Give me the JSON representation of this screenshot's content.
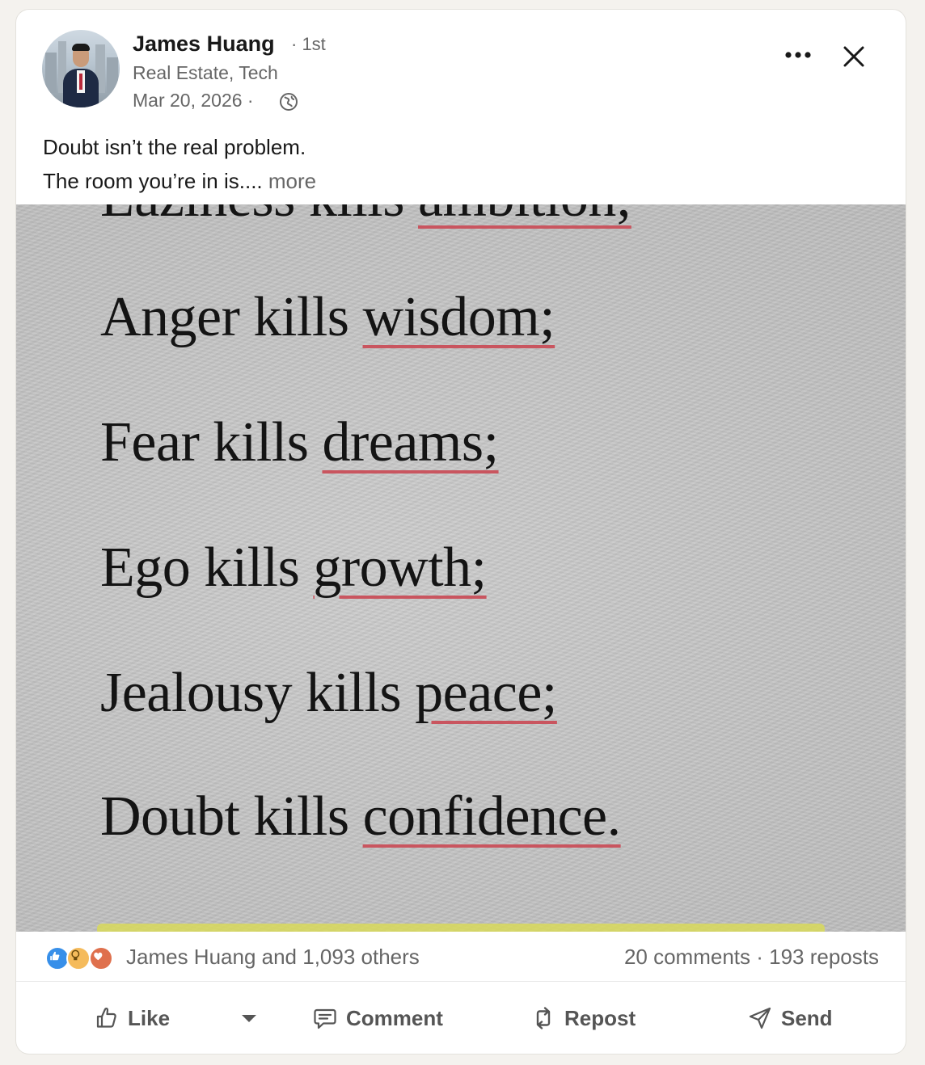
{
  "author": {
    "name": "James Huang",
    "degree": "· 1st",
    "headline": "Real Estate, Tech",
    "date": "Mar 20, 2026 ·",
    "visibility_icon": "globe-icon"
  },
  "post": {
    "line1": "Doubt isn’t the real problem.",
    "line2": "The room you’re in is....",
    "more_label": "more"
  },
  "image_text": {
    "partial_line": {
      "plain": "Laziness kills ",
      "underlined": "ambition;"
    },
    "lines": [
      {
        "plain": "Anger kills ",
        "underlined": "wisdom;"
      },
      {
        "plain": "Fear kills ",
        "underlined": "dreams;"
      },
      {
        "plain": "Ego kills ",
        "underlined": "growth;"
      },
      {
        "plain": "Jealousy kills ",
        "underlined": "peace;"
      },
      {
        "plain": "Doubt kills ",
        "underlined": "confidence."
      }
    ]
  },
  "social": {
    "reaction_icons": [
      "like-reaction-icon",
      "insightful-reaction-icon",
      "love-reaction-icon"
    ],
    "reactors_text": "James Huang and 1,093 others",
    "counts_text": "20 comments · 193 reposts"
  },
  "actions": {
    "like": "Like",
    "comment": "Comment",
    "repost": "Repost",
    "send": "Send"
  },
  "colors": {
    "secondary_text": "#666666",
    "underline": "#c9555f",
    "like_blue": "#378fe9",
    "insight_yellow": "#f5bb5c",
    "love_red": "#df704d"
  }
}
